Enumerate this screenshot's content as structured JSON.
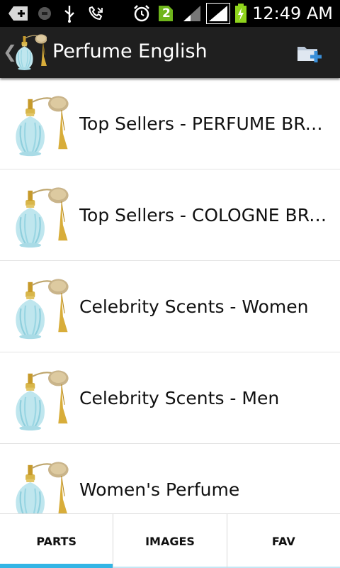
{
  "status_bar": {
    "time": "12:49 AM",
    "notification_count": "2",
    "icons": [
      "add-notification-icon",
      "record-icon",
      "usb-icon",
      "missed-call-icon",
      "alarm-icon",
      "sim-notification-icon",
      "signal-icon",
      "signal-full-icon",
      "battery-charging-icon"
    ]
  },
  "action_bar": {
    "title": "Perfume English",
    "icons": [
      "back-chevron-icon",
      "perfume-app-icon",
      "add-folder-icon"
    ]
  },
  "list": {
    "items": [
      {
        "label": "Top Sellers - PERFUME BRANDS",
        "icon": "perfume-bottle-icon"
      },
      {
        "label": "Top Sellers - COLOGNE BRANDS",
        "icon": "perfume-bottle-icon"
      },
      {
        "label": "Celebrity Scents - Women",
        "icon": "perfume-bottle-icon"
      },
      {
        "label": "Celebrity Scents - Men",
        "icon": "perfume-bottle-icon"
      },
      {
        "label": "Women's Perfume",
        "icon": "perfume-bottle-icon"
      }
    ]
  },
  "tabs": {
    "items": [
      {
        "label": "PARTS",
        "selected": true
      },
      {
        "label": "IMAGES",
        "selected": false
      },
      {
        "label": "FAV",
        "selected": false
      }
    ]
  },
  "colors": {
    "status_bar_bg": "#000000",
    "action_bar_bg": "#1f1f1f",
    "tab_indicator": "#33b5e5",
    "battery_green": "#8fd41c"
  }
}
